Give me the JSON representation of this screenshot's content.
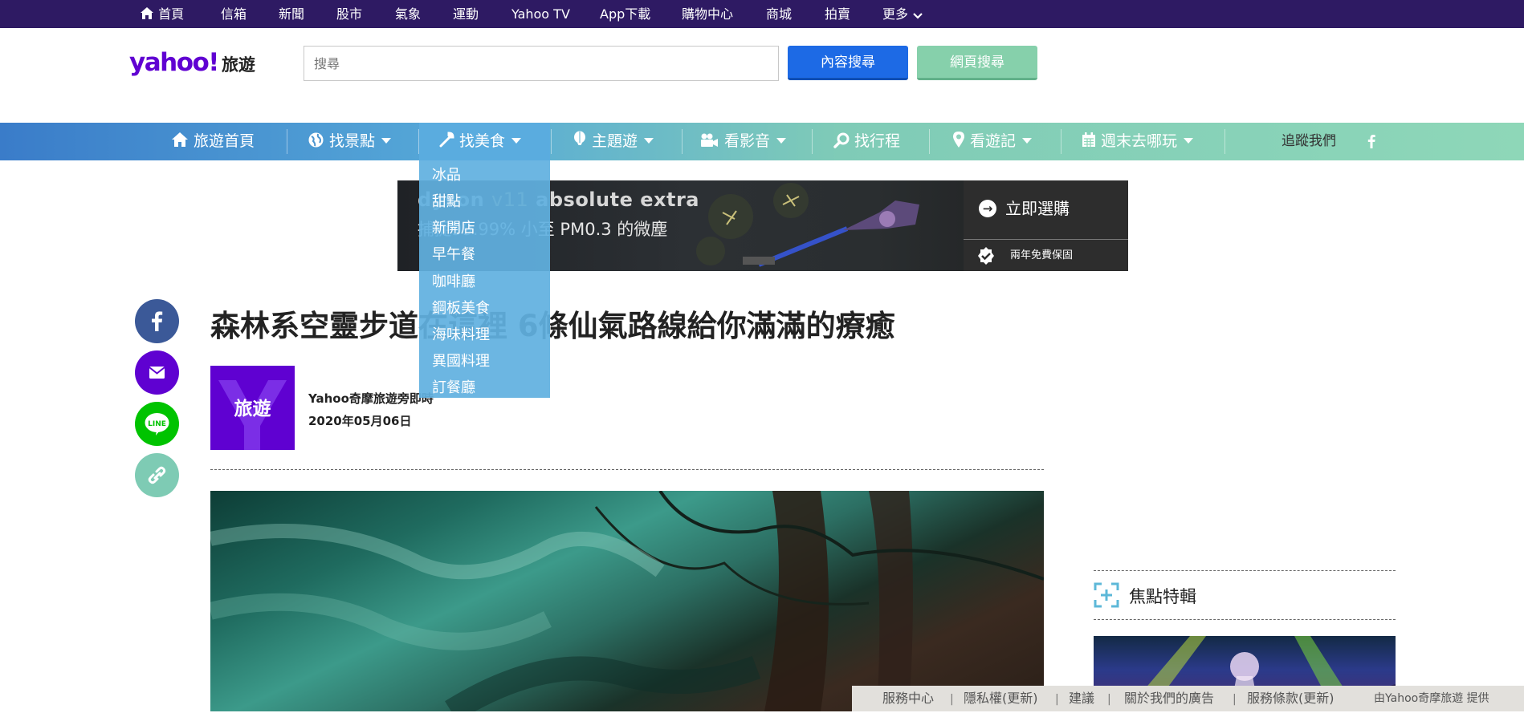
{
  "topbar": {
    "home": "首頁",
    "items": [
      "信箱",
      "新聞",
      "股市",
      "氣象",
      "運動",
      "Yahoo TV",
      "App下載",
      "購物中心",
      "商城",
      "拍賣"
    ],
    "more": "更多"
  },
  "header": {
    "logo": "yahoo!",
    "logo_sub": "旅遊",
    "search_placeholder": "搜尋",
    "content_search": "內容搜尋",
    "web_search": "網頁搜尋"
  },
  "nav": {
    "home": "旅遊首頁",
    "sights": "找景點",
    "food": "找美食",
    "themes": "主題遊",
    "videos": "看影音",
    "itinerary": "找行程",
    "journals": "看遊記",
    "weekend": "週末去哪玩",
    "follow": "追蹤我們",
    "active_color": "#5aacdf"
  },
  "dropdown": [
    "冰品",
    "甜點",
    "新開店",
    "早午餐",
    "咖啡廳",
    "鋼板美食",
    "海味料理",
    "異國料理",
    "訂餐廳"
  ],
  "ad": {
    "brand": "dyson",
    "model": "v11",
    "variant": "absolute extra",
    "tagline": "捕捉99.99% 小至 PM0.3 的微塵",
    "buy": "立即選購",
    "warranty": "兩年免費保固"
  },
  "article": {
    "title": "森林系空靈步道在這裡 6條仙氣路線給你滿滿的療癒",
    "author_logo": "旅遊",
    "author": "Yahoo奇摩旅遊旁即時",
    "date": "2020年05月06日"
  },
  "sidebar": {
    "title": "焦點特輯"
  },
  "footer": {
    "links": [
      "服務中心",
      "隱私權(更新)",
      "建議",
      "關於我們的廣告",
      "服務條款(更新)"
    ],
    "provider": "由Yahoo奇摩旅遊 提供"
  },
  "colors": {
    "topbar": "#2e1a63",
    "brand_purple": "#6001d2",
    "content_search_btn": "#1d6ae5",
    "web_search_btn": "#86d0ab"
  },
  "icons": [
    "home-icon",
    "chevron-down-icon",
    "globe-icon",
    "wrench-icon",
    "balloon-icon",
    "camera-icon",
    "search-icon",
    "map-pin-icon",
    "calendar-icon",
    "facebook-icon",
    "mail-icon",
    "line-icon",
    "link-icon",
    "focus-icon"
  ]
}
